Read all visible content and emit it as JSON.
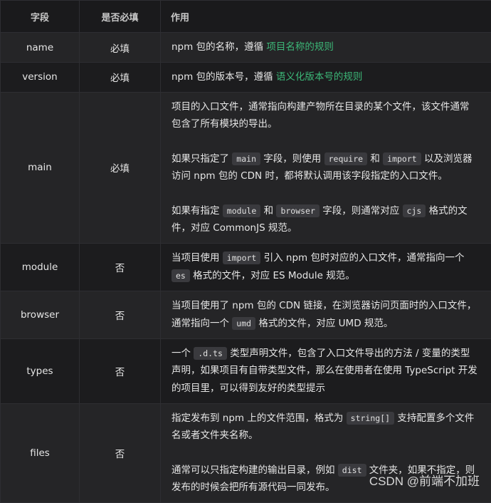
{
  "headers": [
    "字段",
    "是否必填",
    "作用"
  ],
  "rows": [
    {
      "name": "name",
      "required": "必填",
      "paragraphs": [
        [
          {
            "t": "npm 包的名称，遵循 "
          },
          {
            "t": "项目名称的规则",
            "s": "link"
          }
        ]
      ]
    },
    {
      "name": "version",
      "required": "必填",
      "paragraphs": [
        [
          {
            "t": "npm 包的版本号，遵循 "
          },
          {
            "t": "语义化版本号的规则",
            "s": "link"
          }
        ]
      ]
    },
    {
      "name": "main",
      "required": "必填",
      "paragraphs": [
        [
          {
            "t": "项目的入口文件，通常指向构建产物所在目录的某个文件，该文件通常包含了所有模块的导出。"
          }
        ],
        [
          {
            "t": "如果只指定了 "
          },
          {
            "t": "main",
            "s": "code"
          },
          {
            "t": " 字段，则使用 "
          },
          {
            "t": "require",
            "s": "code"
          },
          {
            "t": " 和 "
          },
          {
            "t": "import",
            "s": "code"
          },
          {
            "t": " 以及浏览器访问 npm 包的 CDN 时，都将默认调用该字段指定的入口文件。"
          }
        ],
        [
          {
            "t": "如果有指定 "
          },
          {
            "t": "module",
            "s": "code"
          },
          {
            "t": " 和 "
          },
          {
            "t": "browser",
            "s": "code"
          },
          {
            "t": " 字段，则通常对应 "
          },
          {
            "t": "cjs",
            "s": "code"
          },
          {
            "t": " 格式的文件，对应 CommonJS 规范。"
          }
        ]
      ]
    },
    {
      "name": "module",
      "required": "否",
      "paragraphs": [
        [
          {
            "t": "当项目使用 "
          },
          {
            "t": "import",
            "s": "code"
          },
          {
            "t": " 引入 npm 包时对应的入口文件，通常指向一个 "
          },
          {
            "t": "es",
            "s": "code"
          },
          {
            "t": " 格式的文件，对应 ES Module 规范。"
          }
        ]
      ]
    },
    {
      "name": "browser",
      "required": "否",
      "paragraphs": [
        [
          {
            "t": "当项目使用了 npm 包的 CDN 链接，在浏览器访问页面时的入口文件，通常指向一个 "
          },
          {
            "t": "umd",
            "s": "code"
          },
          {
            "t": " 格式的文件，对应 UMD 规范。"
          }
        ]
      ]
    },
    {
      "name": "types",
      "required": "否",
      "paragraphs": [
        [
          {
            "t": "一个 "
          },
          {
            "t": ".d.ts",
            "s": "code"
          },
          {
            "t": " 类型声明文件，包含了入口文件导出的方法 / 变量的类型声明，如果项目有自带类型文件，那么在使用者在使用 TypeScript 开发的项目里，可以得到友好的类型提示"
          }
        ]
      ]
    },
    {
      "name": "files",
      "required": "否",
      "paragraphs": [
        [
          {
            "t": "指定发布到 npm 上的文件范围，格式为 "
          },
          {
            "t": "string[]",
            "s": "code"
          },
          {
            "t": " 支持配置多个文件名或者文件夹名称。"
          }
        ],
        [
          {
            "t": "通常可以只指定构建的输出目录，例如 "
          },
          {
            "t": "dist",
            "s": "code"
          },
          {
            "t": " 文件夹，如果不指定，则发布的时候会把所有源代码一同发布。"
          }
        ]
      ]
    }
  ],
  "watermark": "CSDN @前端不加班",
  "colors": {
    "link": "#3cb878",
    "background": "#1e1e20"
  }
}
